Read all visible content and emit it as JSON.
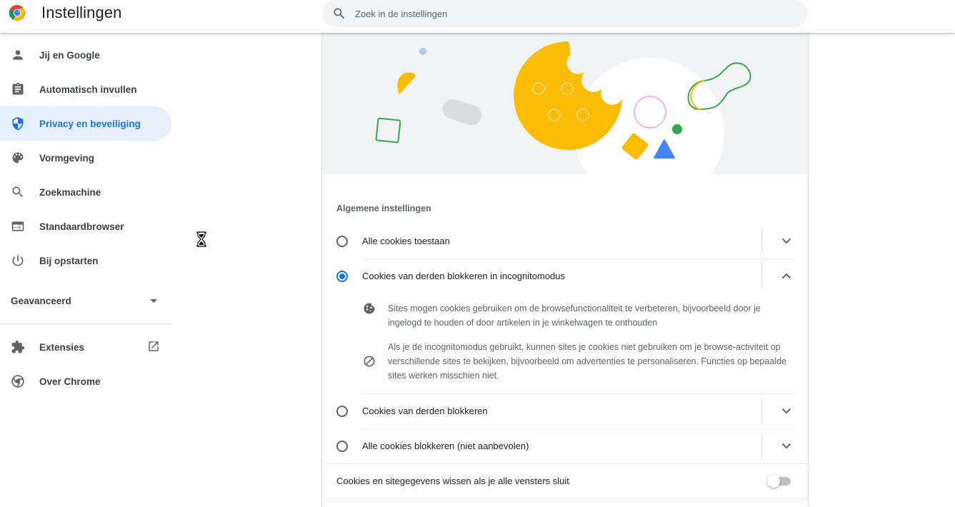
{
  "app": {
    "title": "Instellingen",
    "logo": "chrome-logo"
  },
  "search": {
    "placeholder": "Zoek in de instellingen",
    "value": "",
    "icon": "search-icon"
  },
  "sidebar": {
    "items": [
      {
        "label": "Jij en Google",
        "icon": "person-icon",
        "active": false
      },
      {
        "label": "Automatisch invullen",
        "icon": "clipboard-icon",
        "active": false
      },
      {
        "label": "Privacy en beveiliging",
        "icon": "shield-icon",
        "active": true
      },
      {
        "label": "Vormgeving",
        "icon": "palette-icon",
        "active": false
      },
      {
        "label": "Zoekmachine",
        "icon": "search-icon",
        "active": false
      },
      {
        "label": "Standaardbrowser",
        "icon": "browser-window-icon",
        "active": false
      },
      {
        "label": "Bij opstarten",
        "icon": "power-icon",
        "active": false
      }
    ],
    "advanced_label": "Geavanceerd",
    "extensions_label": "Extensies",
    "about_label": "Over Chrome"
  },
  "colors": {
    "accent": "#1a73e8",
    "active_bg": "#e8f0fe",
    "illustration_yellow": "#fbbc04",
    "illustration_green": "#34a853",
    "illustration_blue": "#4285f4",
    "illustration_pink": "#f3b4e8"
  },
  "cookies": {
    "section_title": "Algemene instellingen",
    "options": [
      {
        "label": "Alle cookies toestaan",
        "selected": false,
        "expanded": false
      },
      {
        "label": "Cookies van derden blokkeren in incognitomodus",
        "selected": true,
        "expanded": true
      },
      {
        "label": "Cookies van derden blokkeren",
        "selected": false,
        "expanded": false
      },
      {
        "label": "Alle cookies blokkeren (niet aanbevolen)",
        "selected": false,
        "expanded": false
      }
    ],
    "details": [
      {
        "icon": "cookie-icon",
        "text": "Sites mogen cookies gebruiken om de browsefunctionaliteit te verbeteren, bijvoorbeeld door je ingelogd te houden of door artikelen in je winkelwagen te onthouden"
      },
      {
        "icon": "block-icon",
        "text": "Als je de incognitomodus gebruikt, kunnen sites je cookies niet gebruiken om je browse-activiteit op verschillende sites te bekijken, bijvoorbeeld om advertenties te personaliseren. Functies op bepaalde sites werken misschien niet."
      }
    ],
    "clear_on_exit_label": "Cookies en sitegegevens wissen als je alle vensters sluit",
    "clear_on_exit_enabled": false
  }
}
